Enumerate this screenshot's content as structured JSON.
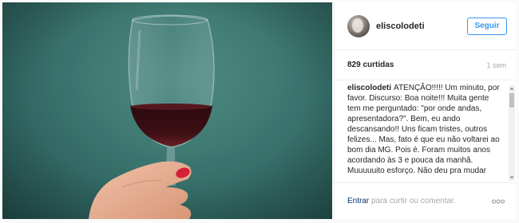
{
  "post": {
    "username": "eliscolodeti",
    "follow_label": "Seguir",
    "likes": "829 curtidas",
    "time_ago": "1 sem",
    "caption": {
      "username": "eliscolodeti",
      "text": "ATENÇÃO!!!!! Um minuto, por favor. Discurso: Boa noite!!! Muita gente tem me perguntado: \"por onde andas, apresentadora?\". Bem, eu ando descansando!! Uns ficam tristes, outros felizes... Mas, fato é que eu não voltarei ao bom dia MG. Pois é. Foram muitos anos acordando às 3 e pouca da manhã. Muuuuuito esforço. Não deu pra mudar"
    },
    "login_prompt": {
      "link": "Entrar",
      "rest": " para curtir ou comentar."
    }
  },
  "icons": {
    "more": "ellipsis-icon",
    "avatar": "avatar"
  },
  "colors": {
    "accent": "#3897f0",
    "background": "#fafafa",
    "muted": "#a5a7aa",
    "photo_bg": "#3f7a73",
    "wine": "#3a0f14"
  }
}
